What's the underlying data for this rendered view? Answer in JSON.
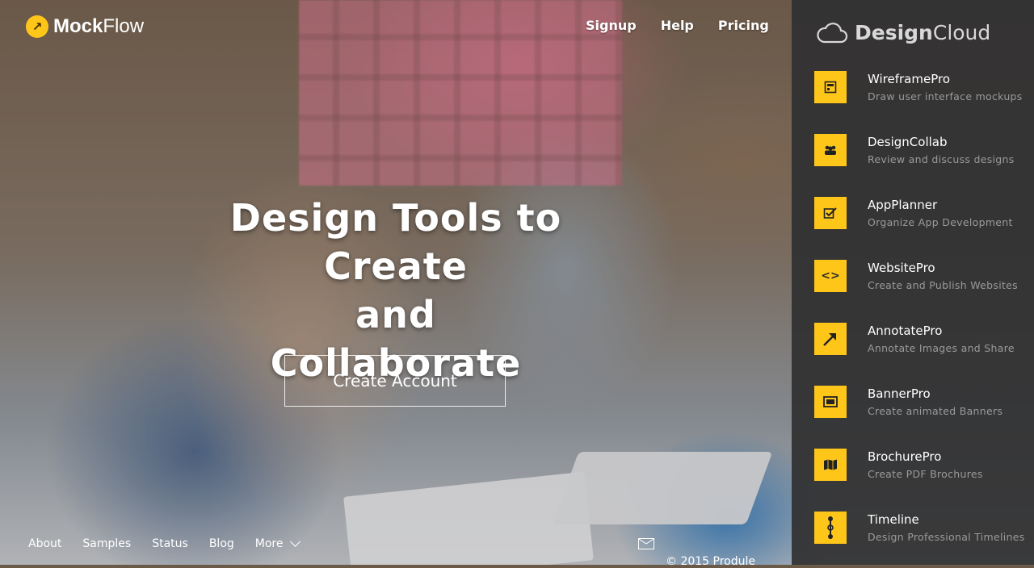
{
  "header": {
    "logo_bold": "Mock",
    "logo_light": "Flow",
    "nav": [
      "Signup",
      "Help",
      "Pricing"
    ]
  },
  "hero": {
    "headline_line1": "Design Tools to Create",
    "headline_line2": "and Collaborate",
    "cta_label": "Create Account"
  },
  "footer": {
    "links": [
      "About",
      "Samples",
      "Status",
      "Blog"
    ],
    "more_label": "More",
    "copyright": "© 2015 Produle"
  },
  "panel": {
    "brand_bold": "Design",
    "brand_light": "Cloud",
    "items": [
      {
        "title": "WireframePro",
        "desc": "Draw user interface mockups",
        "icon": "wireframe-icon"
      },
      {
        "title": "DesignCollab",
        "desc": "Review and discuss designs",
        "icon": "group-icon"
      },
      {
        "title": "AppPlanner",
        "desc": "Organize App Development",
        "icon": "checkbox-icon"
      },
      {
        "title": "WebsitePro",
        "desc": "Create and Publish Websites",
        "icon": "code-icon"
      },
      {
        "title": "AnnotatePro",
        "desc": "Annotate Images and Share",
        "icon": "arrow-icon"
      },
      {
        "title": "BannerPro",
        "desc": "Create animated Banners",
        "icon": "banner-icon"
      },
      {
        "title": "BrochurePro",
        "desc": "Create PDF Brochures",
        "icon": "map-icon"
      },
      {
        "title": "Timeline",
        "desc": "Design Professional Timelines",
        "icon": "timeline-icon"
      }
    ]
  },
  "colors": {
    "accent": "#ffc61a",
    "panel_bg": "#303032"
  }
}
